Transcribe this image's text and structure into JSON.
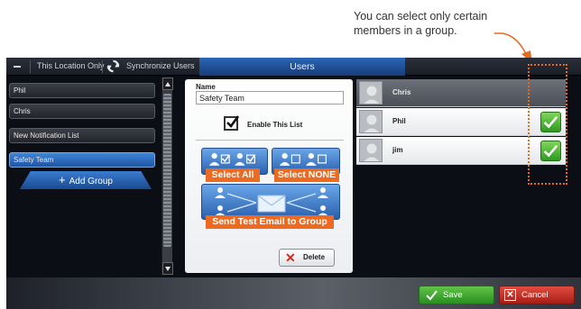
{
  "annotation": {
    "line1": "You can select only certain",
    "line2": "members in a group.",
    "color": "#e86a1e"
  },
  "topbar": {
    "location_label": "This Location Only",
    "sync_label": "Synchronize Users",
    "title": "Users"
  },
  "lists": {
    "items": [
      {
        "label": "Phil",
        "selected": false
      },
      {
        "label": "Chris",
        "selected": false
      },
      {
        "label": "New Notification List",
        "selected": false
      },
      {
        "label": "Safety Team",
        "selected": true
      }
    ],
    "add_group_label": "Add Group"
  },
  "editor": {
    "name_label": "Name",
    "name_value": "Safety Team",
    "enable_label": "Enable This List",
    "enable_checked": true,
    "select_all_label": "Select All",
    "select_none_label": "Select NONE",
    "send_test_label": "Send Test Email to Group",
    "delete_label": "Delete"
  },
  "members": [
    {
      "name": "Chris",
      "checked": false
    },
    {
      "name": "Phil",
      "checked": true
    },
    {
      "name": "jim",
      "checked": true
    }
  ],
  "footer": {
    "save_label": "Save",
    "cancel_label": "Cancel"
  },
  "colors": {
    "accent_blue": "#2b66b6",
    "orange": "#ee6a20",
    "save_green": "#2a8e21",
    "cancel_red": "#a51d16"
  }
}
